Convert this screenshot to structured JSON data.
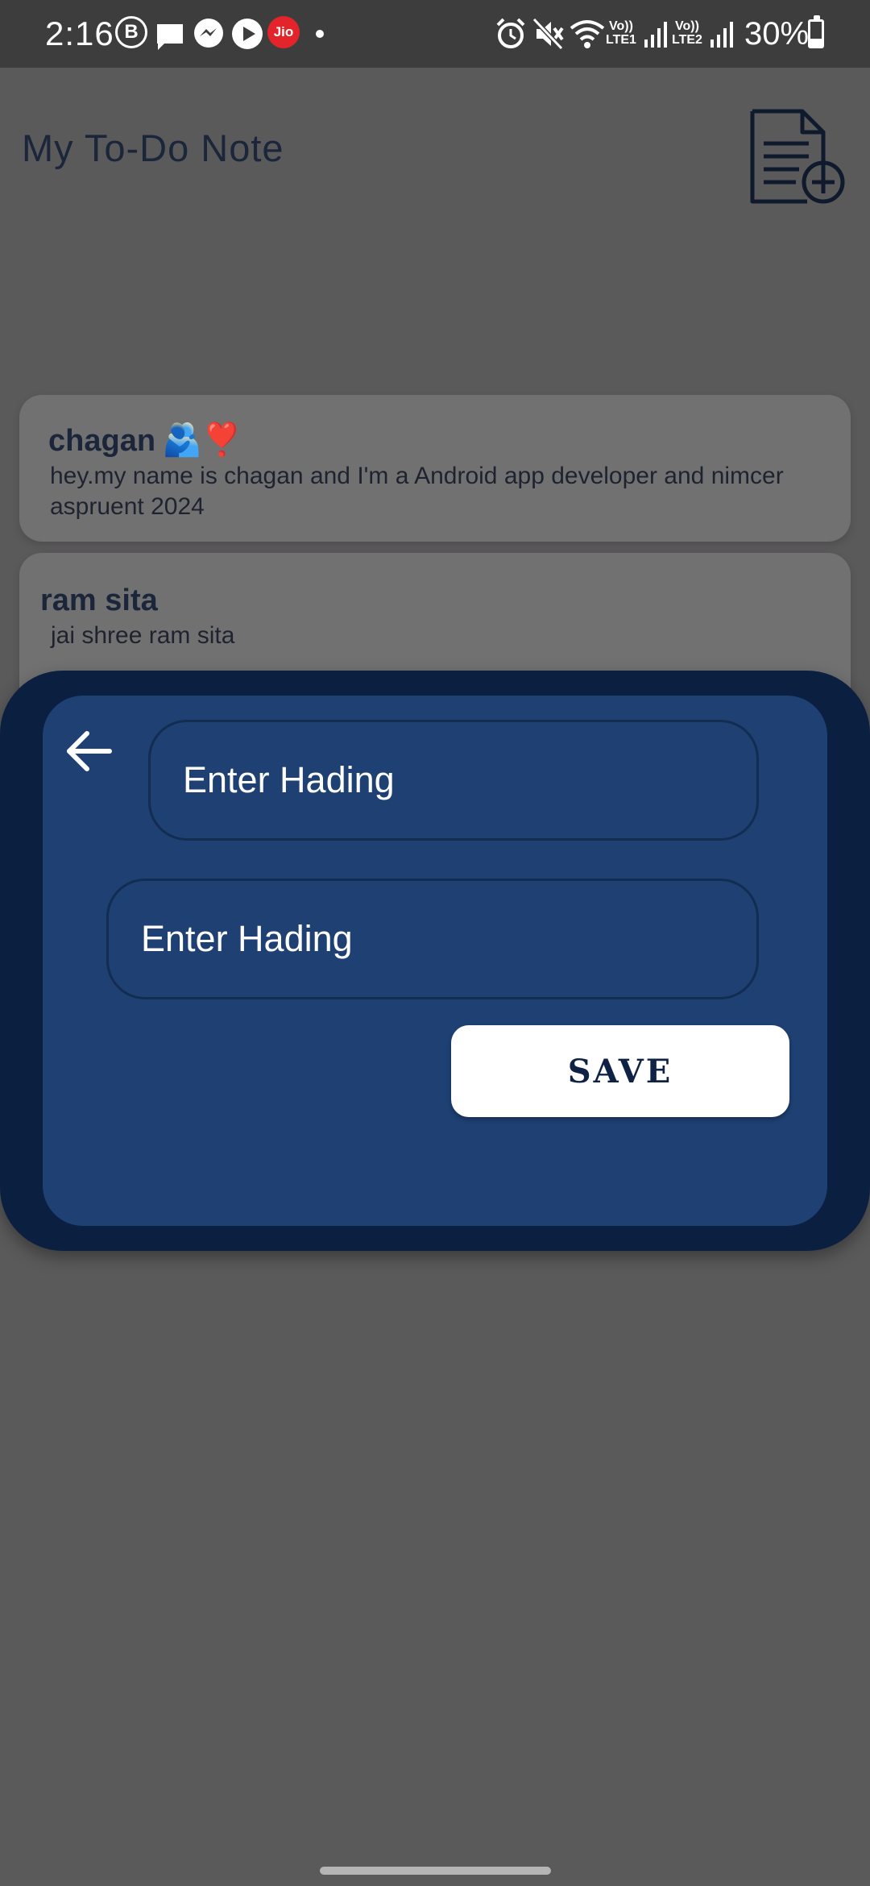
{
  "status_bar": {
    "time": "2:16",
    "b_label": "B",
    "jio_label": "Jio",
    "lte1": "Vo))\nLTE1",
    "lte2": "Vo))\nLTE2",
    "battery_text": "30%",
    "battery_level": 0.3,
    "icons": [
      "business-b-icon",
      "message-icon",
      "messenger-icon",
      "youtube-icon",
      "jio-icon",
      "notification-dot-icon",
      "alarm-icon",
      "mute-icon",
      "wifi-icon",
      "signal1-icon",
      "signal2-icon",
      "battery-icon"
    ]
  },
  "app": {
    "title": "My To-Do Note",
    "add_note_icon": "note-add-icon"
  },
  "notes": [
    {
      "heading": "chagan",
      "emoji": "🫂❣️",
      "body": "hey.my name is chagan and I'm a Android app developer and nimcer aspruent 2024"
    },
    {
      "heading": "ram sita",
      "emoji": "",
      "body": "jai shree ram sita"
    }
  ],
  "dialog": {
    "back_icon": "arrow-left-icon",
    "heading_placeholder": "Enter Hading",
    "body_placeholder": "Enter Hading",
    "save_label": "SAVE"
  },
  "colors": {
    "background": "#5b5a5b",
    "card": "#727171",
    "sheet_outer": "#0b1f40",
    "sheet_inner": "#1e4073",
    "title_text": "#1b263b",
    "save_text": "#0f2246"
  }
}
